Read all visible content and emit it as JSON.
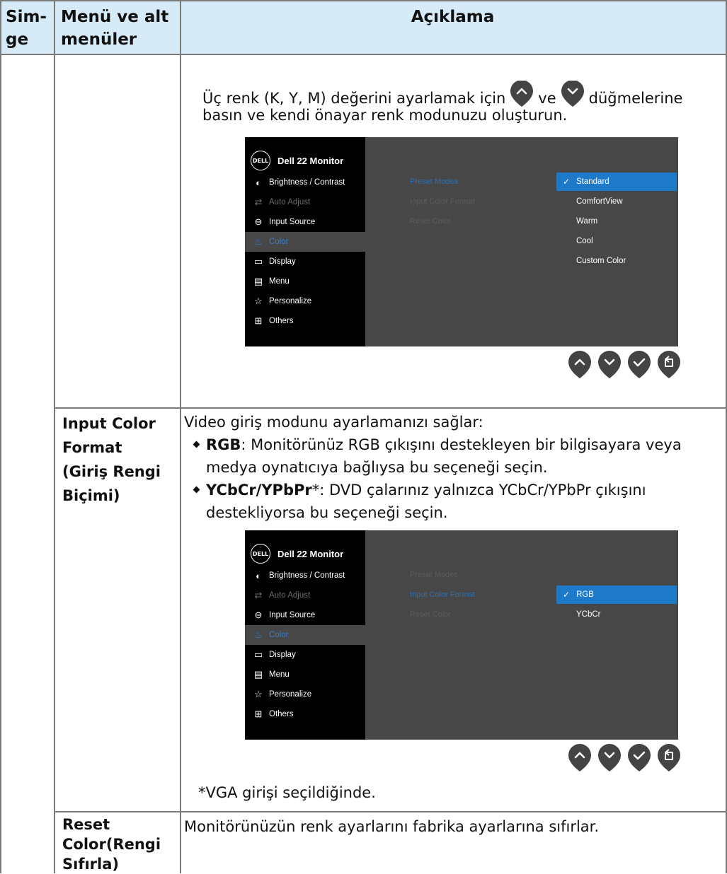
{
  "header": {
    "col1": "Sim-\nge",
    "col1_a": "Sim-",
    "col1_b": "ge",
    "col2_a": "Menü ve alt",
    "col2_b": "menüler",
    "col3": "Açıklama"
  },
  "row1": {
    "line1_pre": "Üç renk (K, Y, M) değerini ayarlamak için",
    "line1_mid": "ve",
    "line1_post": "düğmelerine",
    "line2": "basın ve kendi önayar renk modunuzu oluşturun."
  },
  "osd1": {
    "logo": "DELL",
    "title": "Dell 22 Monitor",
    "menu": [
      {
        "label": "Brightness / Contrast",
        "icon": "brightness-icon"
      },
      {
        "label": "Auto Adjust",
        "icon": "auto-adjust-icon"
      },
      {
        "label": "Input Source",
        "icon": "input-source-icon"
      },
      {
        "label": "Color",
        "icon": "color-icon"
      },
      {
        "label": "Display",
        "icon": "display-icon"
      },
      {
        "label": "Menu",
        "icon": "menu-icon"
      },
      {
        "label": "Personalize",
        "icon": "star-icon"
      },
      {
        "label": "Others",
        "icon": "others-icon"
      }
    ],
    "submenu": [
      "Preset Modes",
      "Input Color Format",
      "Reset Color"
    ],
    "options": [
      "Standard",
      "ComfortView",
      "Warm",
      "Cool",
      "Custom Color"
    ]
  },
  "row2": {
    "title_lines": [
      "Input Color",
      "Format",
      "(Giriş Rengi",
      "Biçimi)"
    ],
    "intro": "Video giriş modunu ayarlamanızı sağlar:",
    "b1_label": "RGB",
    "b1_text_a": ": Monitörünüz RGB çıkışını destekleyen bir bilgisayara veya",
    "b1_text_b": "medya oynatıcıya bağlıysa bu seçeneği seçin.",
    "b2_label": "YCbCr/YPbPr",
    "b2_star": "*",
    "b2_text_a": ": DVD çalarınız yalnızca YCbCr/YPbPr çıkışını",
    "b2_text_b": "destekliyorsa bu seçeneği seçin.",
    "footnote": "*VGA girişi seçildiğinde."
  },
  "osd2": {
    "logo": "DELL",
    "title": "Dell 22 Monitor",
    "submenu": [
      "Preset Modes",
      "Input Color Format",
      "Reset Color"
    ],
    "options": [
      "RGB",
      "YCbCr"
    ]
  },
  "row3": {
    "title_lines": [
      "Reset",
      "Color(Rengi",
      "Sıfırla)"
    ],
    "text": "Monitörünüzün renk ayarlarını fabrika ayarlarına sıfırlar."
  },
  "colors": {
    "header_bg": "#d7eaf7",
    "osd_bg": "#474747",
    "osd_side": "#000000",
    "highlight": "#1f79c9",
    "button": "#444444"
  }
}
